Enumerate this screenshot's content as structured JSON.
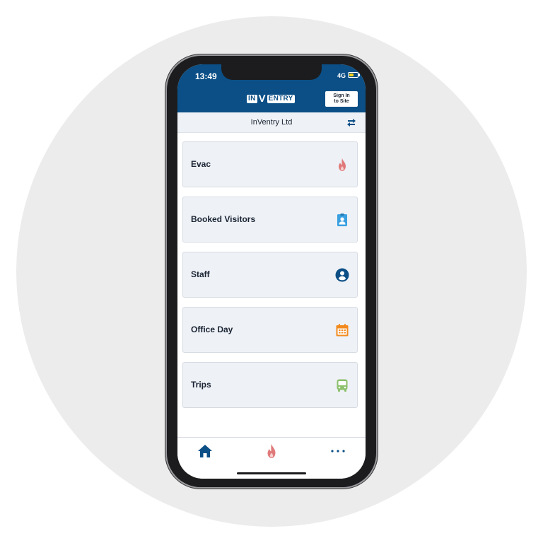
{
  "status_bar": {
    "time": "13:49",
    "network": "4G",
    "battery_level": 0.55,
    "battery_color": "#f5d21b"
  },
  "header": {
    "logo": {
      "part1": "IN",
      "part2": "V",
      "part3": "ENTRY"
    },
    "sign_in_line1": "Sign In",
    "sign_in_line2": "to Site",
    "background_color": "#0b4f86"
  },
  "subheader": {
    "company": "InVentry Ltd",
    "switch_icon": "swap-arrows-icon"
  },
  "menu": {
    "items": [
      {
        "label": "Evac",
        "icon": "flame-icon",
        "color": "#e07a7a"
      },
      {
        "label": "Booked Visitors",
        "icon": "visitor-badge-icon",
        "color": "#3aa0e0"
      },
      {
        "label": "Staff",
        "icon": "person-circle-icon",
        "color": "#0b4f86"
      },
      {
        "label": "Office Day",
        "icon": "calendar-icon",
        "color": "#f28a1e"
      },
      {
        "label": "Trips",
        "icon": "bus-icon",
        "color": "#8cc06a"
      }
    ]
  },
  "tabbar": {
    "items": [
      {
        "icon": "home-icon",
        "color": "#0b4f86"
      },
      {
        "icon": "flame-icon",
        "color": "#e07a7a"
      },
      {
        "icon": "more-icon",
        "color": "#0b4f86"
      }
    ]
  }
}
